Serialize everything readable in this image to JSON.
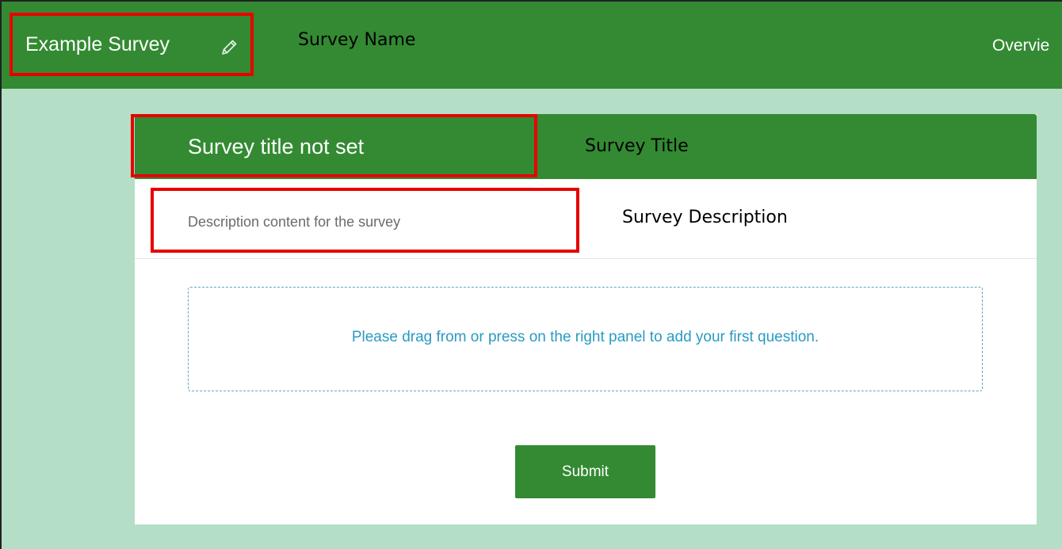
{
  "header": {
    "survey_name": "Example Survey",
    "overview_tab": "Overvie"
  },
  "annotations": {
    "survey_name": "Survey Name",
    "survey_title": "Survey Title",
    "survey_description": "Survey Description"
  },
  "card": {
    "title": "Survey title not set",
    "description": "Description content for the survey",
    "dropzone_text": "Please drag from or press on the right panel to add your first question.",
    "submit_label": "Submit"
  },
  "icons": {
    "edit": "pencil-icon"
  },
  "colors": {
    "brand_green": "#338a32",
    "page_background": "#b5dec6",
    "annotation_red": "#e80000",
    "dropzone_blue": "#2a9ac2"
  }
}
